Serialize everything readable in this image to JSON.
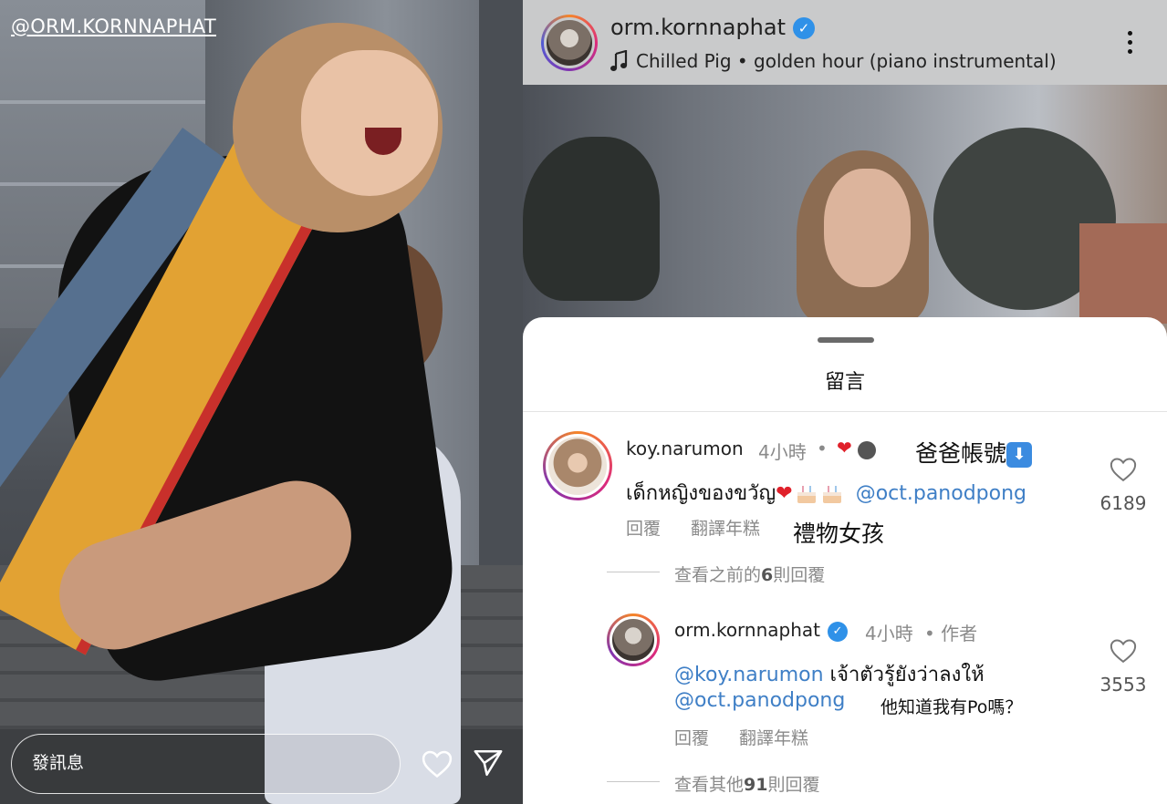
{
  "story": {
    "username": "@ORM.KORNNAPHAT",
    "message_placeholder": "發訊息",
    "heart_icon": "heart-icon",
    "send_icon": "send-icon"
  },
  "post": {
    "username": "orm.kornnaphat",
    "music": "Chilled Pig • golden hour (piano instrumental)",
    "music_icon": "music-note-icon",
    "more_icon": "more-vertical-icon"
  },
  "comments_sheet": {
    "title": "留言",
    "comment1": {
      "username": "koy.narumon",
      "time": "4小時",
      "dot": "•",
      "text": "เด็กหญิงของขวัญ",
      "mention": "@oct.panodpong",
      "reply": "回覆",
      "translate": "翻譯年糕",
      "likes": "6189",
      "annotation_top": "爸爸帳號",
      "annotation_bottom": "禮物女孩",
      "view_previous_prefix": "查看之前的",
      "view_previous_count": "6",
      "view_previous_suffix": "則回覆"
    },
    "comment2": {
      "username": "orm.kornnaphat",
      "time": "4小時",
      "author_tag": "• 作者",
      "mention1": "@koy.narumon",
      "text": "เจ้าตัวรู้ยังว่าลงให้",
      "mention2": "@oct.panodpong",
      "annotation": "他知道我有Po嗎？",
      "reply": "回覆",
      "translate": "翻譯年糕",
      "likes": "3553",
      "view_more_prefix": "查看其他",
      "view_more_count": "91",
      "view_more_suffix": "則回覆"
    }
  },
  "colors": {
    "mention": "#3f7fc6",
    "verified": "#2f91e8",
    "like_heart": "#e0202a"
  }
}
